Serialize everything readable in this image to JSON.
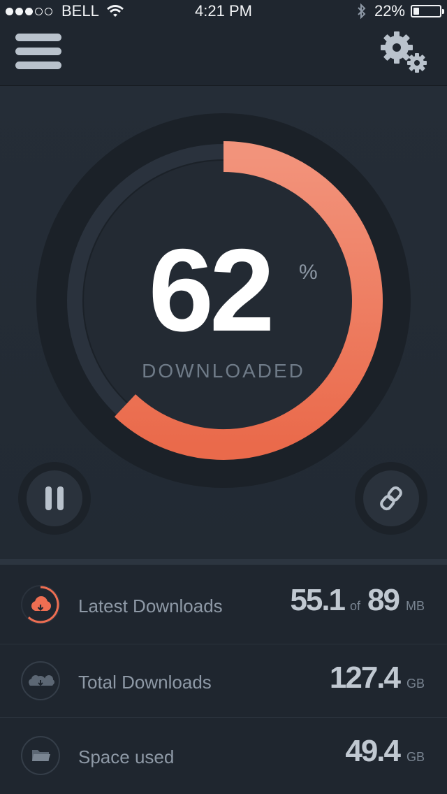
{
  "status_bar": {
    "carrier": "BELL",
    "time": "4:21 PM",
    "battery_percent": "22%",
    "battery_level": 0.22,
    "signal_bars_total": 5,
    "signal_bars_filled": 3
  },
  "header": {
    "menu_icon": "hamburger-menu-icon",
    "settings_icon": "gears-icon"
  },
  "progress": {
    "value": "62",
    "percent_sign": "%",
    "fraction": 0.62,
    "label": "DOWNLOADED",
    "accent_color": "#ee6e52"
  },
  "controls": {
    "pause_icon": "pause-icon",
    "link_icon": "link-icon"
  },
  "stats": [
    {
      "icon": "cloud-download-icon",
      "label": "Latest Downloads",
      "value": "55.1",
      "of_text": "of",
      "total": "89",
      "unit": "MB"
    },
    {
      "icon": "clouds-icon",
      "label": "Total Downloads",
      "value": "127.4",
      "unit": "GB"
    },
    {
      "icon": "folder-icon",
      "label": "Space used",
      "value": "49.4",
      "unit": "GB"
    }
  ]
}
